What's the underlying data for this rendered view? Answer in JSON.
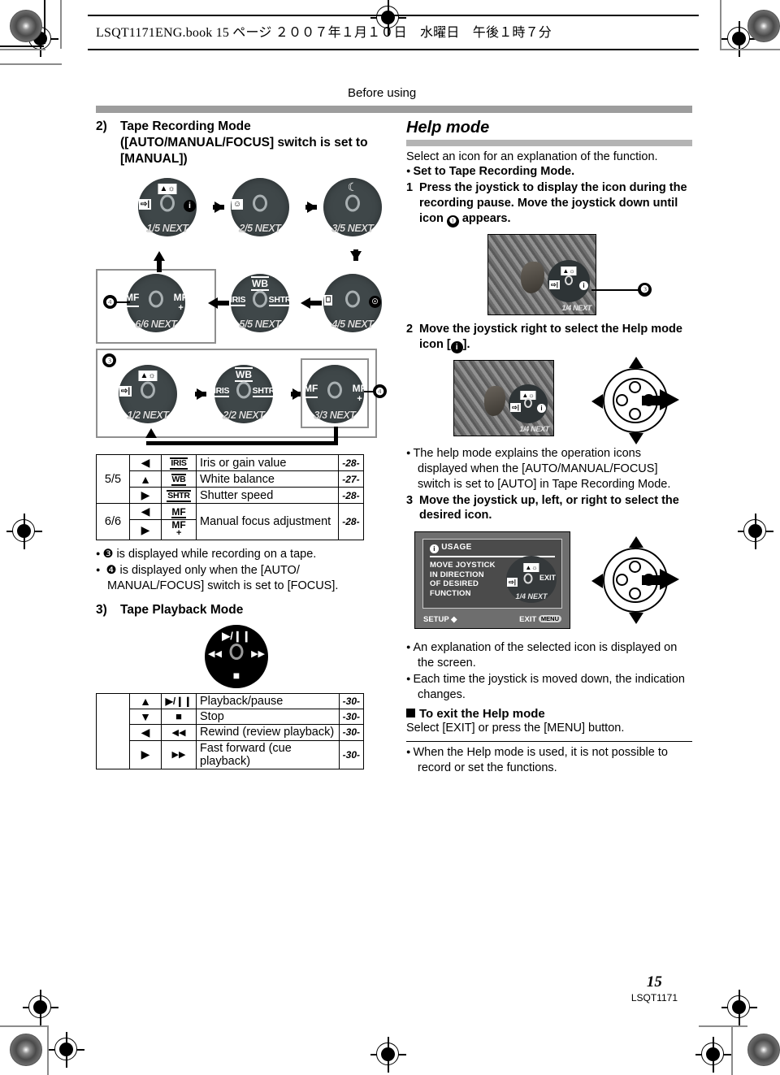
{
  "header": {
    "running_head": "LSQT1171ENG.book    15 ページ    ２００７年１月１０日　水曜日　午後１時７分",
    "section_title": "Before using"
  },
  "left": {
    "item2": {
      "number": "2)",
      "title_line1": "Tape Recording Mode",
      "title_line2": "([AUTO/MANUAL/FOCUS] switch is set to",
      "title_line3": "[MANUAL])"
    },
    "manual_diagram": {
      "steps": [
        {
          "label": "1/5 NEXT",
          "top": "scene-icon",
          "left": "exit-icon",
          "right": "info-icon"
        },
        {
          "label": "2/5 NEXT",
          "left": "soft-skin-icon"
        },
        {
          "label": "3/5 NEXT",
          "top": "night-mode-icon"
        },
        {
          "label": "4/5 NEXT",
          "left": "fade-icon",
          "right": "backlight-icon"
        },
        {
          "label": "5/5 NEXT",
          "top": "WB",
          "left": "IRIS",
          "right": "SHTR"
        },
        {
          "label": "6/6 NEXT",
          "left": "MF−",
          "right": "MF+"
        }
      ],
      "marker_two": "❹"
    },
    "auto_diagram": {
      "marker_one": "❸",
      "marker_two": "❹",
      "steps": [
        {
          "label": "1/2 NEXT",
          "top": "scene-icon",
          "left": "exit-icon"
        },
        {
          "label": "2/2 NEXT",
          "top": "WB",
          "left": "IRIS",
          "right": "SHTR"
        },
        {
          "label": "3/3 NEXT",
          "left": "MF−",
          "right": "MF+"
        }
      ]
    },
    "function_table": [
      {
        "section": "5/5",
        "dir": "◀",
        "icon": "IRIS",
        "icon_type": "boxed",
        "desc": "Iris or gain value",
        "page": "-28-"
      },
      {
        "section": "",
        "dir": "▲",
        "icon": "WB",
        "icon_type": "boxed",
        "desc": "White balance",
        "page": "-27-"
      },
      {
        "section": "",
        "dir": "▶",
        "icon": "SHTR",
        "icon_type": "boxed",
        "desc": "Shutter speed",
        "page": "-28-"
      },
      {
        "section": "6/6",
        "dir": "◀",
        "icon": "MF−",
        "icon_type": "mf",
        "desc": "Manual focus adjustment",
        "page": "-28-"
      },
      {
        "section": "",
        "dir": "▶",
        "icon": "MF+",
        "icon_type": "mf",
        "desc": "",
        "page": ""
      }
    ],
    "notes": [
      "❸ is displayed while recording on a tape.",
      "❹ is displayed only when the [AUTO/",
      "MANUAL/FOCUS] switch is set to [FOCUS]."
    ],
    "item3": {
      "number": "3)",
      "title": "Tape Playback Mode"
    },
    "playback_joystick": {
      "up": "▶/❙❙",
      "down": "■",
      "left": "◀◀",
      "right": "▶▶"
    },
    "playback_table": [
      {
        "dir": "▲",
        "icon": "play-pause",
        "desc": "Playback/pause",
        "page": "-30-"
      },
      {
        "dir": "▼",
        "icon": "stop",
        "desc": "Stop",
        "page": "-30-"
      },
      {
        "dir": "◀",
        "icon": "rewind",
        "desc": "Rewind (review playback)",
        "page": "-30-"
      },
      {
        "dir": "▶",
        "icon": "fast-forward",
        "desc": "Fast forward (cue playback)",
        "page": "-30-"
      }
    ]
  },
  "right": {
    "title": "Help mode",
    "intro": "Select an icon for an explanation of the function.",
    "bullet_set": "Set to Tape Recording Mode.",
    "step1": {
      "num": "1",
      "text": "Press the joystick to display the icon during the recording pause. Move the joystick down until icon ❸ appears."
    },
    "photo1": {
      "osd_label": "1/4 NEXT",
      "callout": "❸"
    },
    "step2": {
      "num": "2",
      "text": "Move the joystick right to select the Help mode icon [i]."
    },
    "photo2": {
      "osd_label": "1/4 NEXT"
    },
    "bullet_help": "The help mode explains the operation icons displayed  when the [AUTO/MANUAL/FOCUS] switch is set to [AUTO] in Tape Recording Mode.",
    "step3": {
      "num": "3",
      "text": "Move the joystick up, left, or right to select the desired icon."
    },
    "lcd": {
      "title": "USAGE",
      "body_lines": [
        "MOVE JOYSTICK",
        "IN DIRECTION",
        "OF DESIRED",
        "FUNCTION"
      ],
      "osd_exit": "EXIT",
      "osd_next": "1/4 NEXT",
      "footer_left": "SETUP",
      "footer_right": "EXIT",
      "footer_right_btn": "MENU"
    },
    "bullets_after": [
      "An explanation of the selected icon is displayed on the screen.",
      "Each time the joystick is moved down, the indication changes."
    ],
    "exit_heading": "To exit the Help mode",
    "exit_text": "Select [EXIT] or press the [MENU] button.",
    "final_note": "When the Help mode is used, it is not possible to record or set the functions."
  },
  "footer": {
    "page_number": "15",
    "doc_code": "LSQT1171"
  },
  "colors": {
    "section_bar": "#9d9d9d",
    "joystick_disc": "#3f4749",
    "gray_frame": "#8f8f8f"
  }
}
